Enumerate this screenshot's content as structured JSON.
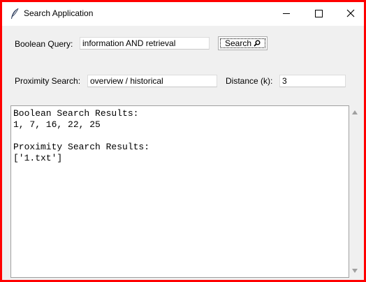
{
  "window": {
    "title": "Search Application"
  },
  "boolean": {
    "label": "Boolean Query:",
    "value": "information AND retrieval"
  },
  "search_button": {
    "label": "Search",
    "icon": "magnifier-icon"
  },
  "proximity": {
    "label": "Proximity Search:",
    "value": "overview / historical"
  },
  "distance": {
    "label": "Distance (k):",
    "value": "3"
  },
  "results": {
    "text": "Boolean Search Results:\n1, 7, 16, 22, 25\n\nProximity Search Results:\n['1.txt']"
  },
  "colors": {
    "border": "#ff0000",
    "background": "#f0f0f0"
  }
}
